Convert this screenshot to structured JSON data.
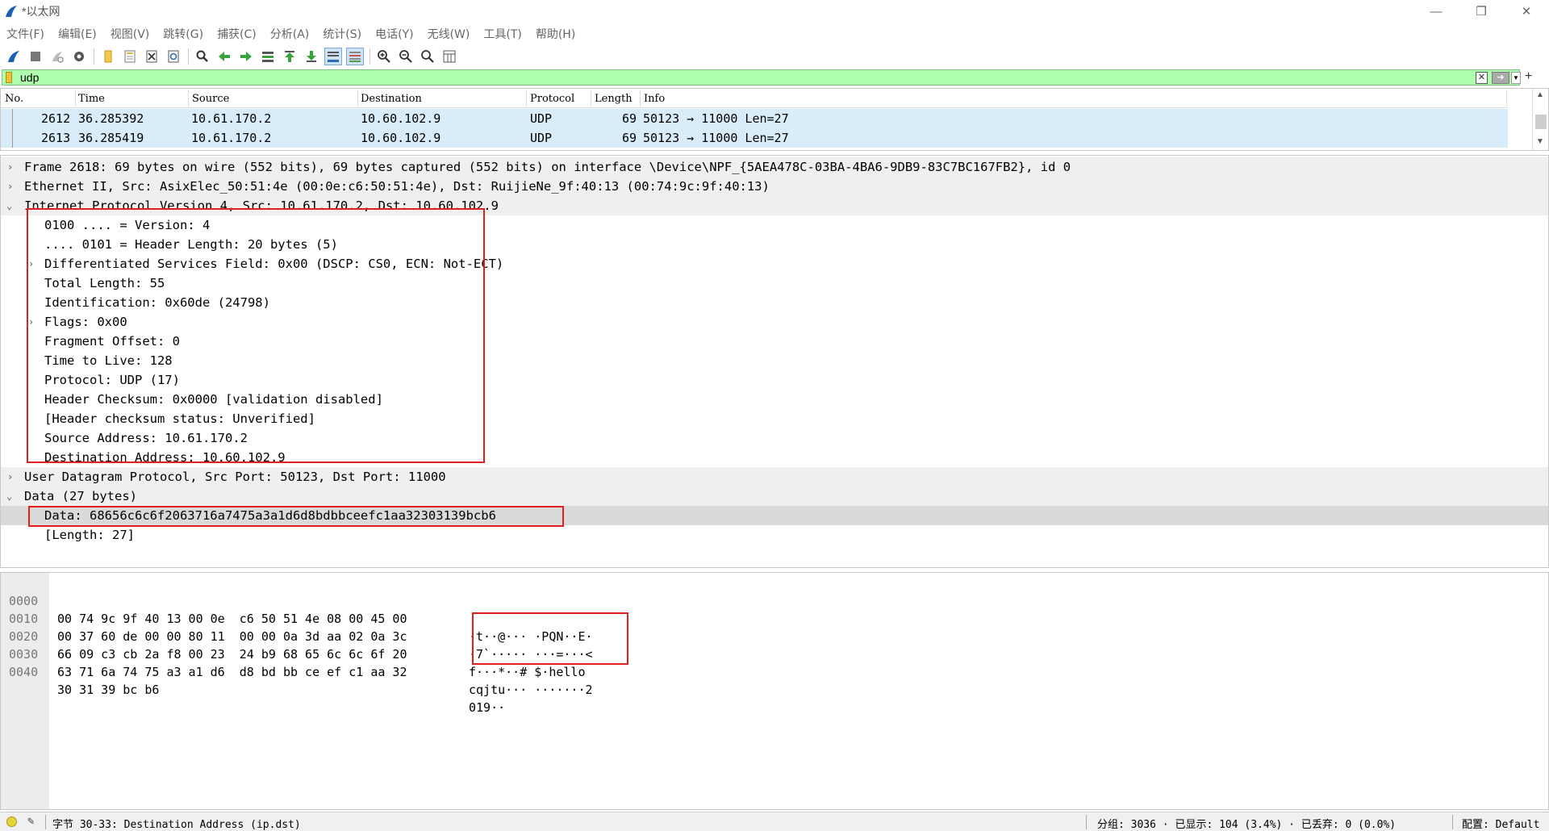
{
  "window": {
    "title": "*以太网",
    "controls": [
      "minimize-icon",
      "restore-icon",
      "close-icon"
    ]
  },
  "menu": [
    "文件(F)",
    "编辑(E)",
    "视图(V)",
    "跳转(G)",
    "捕获(C)",
    "分析(A)",
    "统计(S)",
    "电话(Y)",
    "无线(W)",
    "工具(T)",
    "帮助(H)"
  ],
  "toolbar": {
    "icons": [
      "shark-fin-start-icon",
      "stop-square-icon",
      "restart-capture-icon",
      "capture-options-gear-icon",
      "open-folder-icon",
      "save-file-icon",
      "close-file-icon",
      "reload-icon",
      "find-packet-icon",
      "go-back-icon",
      "go-forward-icon",
      "go-to-packet-icon",
      "go-first-icon",
      "go-last-icon",
      "autoscroll-icon",
      "colorize-icon",
      "zoom-in-icon",
      "zoom-out-icon",
      "zoom-reset-icon",
      "resize-columns-icon"
    ]
  },
  "filter": {
    "value": "udp",
    "color": "#afffaf"
  },
  "packet_list": {
    "columns": [
      "No.",
      "Time",
      "Source",
      "Destination",
      "Protocol",
      "Length",
      "Info"
    ],
    "rows": [
      {
        "no": "2612",
        "time": "36.285392",
        "src": "10.61.170.2",
        "dst": "10.60.102.9",
        "proto": "UDP",
        "len": "69",
        "info": "50123 → 11000 Len=27"
      },
      {
        "no": "2613",
        "time": "36.285419",
        "src": "10.61.170.2",
        "dst": "10.60.102.9",
        "proto": "UDP",
        "len": "69",
        "info": "50123 → 11000 Len=27"
      }
    ],
    "row_color": "#d9ecfa"
  },
  "detail": {
    "lines": [
      {
        "indent": 0,
        "expander": "collapsed",
        "text": "Frame 2618: 69 bytes on wire (552 bits), 69 bytes captured (552 bits) on interface \\Device\\NPF_{5AEA478C-03BA-4BA6-9DB9-83C7BC167FB2}, id 0"
      },
      {
        "indent": 0,
        "expander": "collapsed",
        "text": "Ethernet II, Src: AsixElec_50:51:4e (00:0e:c6:50:51:4e), Dst: RuijieNe_9f:40:13 (00:74:9c:9f:40:13)"
      },
      {
        "indent": 0,
        "expander": "expanded",
        "text": "Internet Protocol Version 4, Src: 10.61.170.2, Dst: 10.60.102.9"
      },
      {
        "indent": 1,
        "expander": "none",
        "text": "0100 .... = Version: 4"
      },
      {
        "indent": 1,
        "expander": "none",
        "text": ".... 0101 = Header Length: 20 bytes (5)"
      },
      {
        "indent": 1,
        "expander": "collapsed",
        "text": "Differentiated Services Field: 0x00 (DSCP: CS0, ECN: Not-ECT)"
      },
      {
        "indent": 1,
        "expander": "none",
        "text": "Total Length: 55"
      },
      {
        "indent": 1,
        "expander": "none",
        "text": "Identification: 0x60de (24798)"
      },
      {
        "indent": 1,
        "expander": "collapsed",
        "text": "Flags: 0x00"
      },
      {
        "indent": 1,
        "expander": "none",
        "text": "Fragment Offset: 0"
      },
      {
        "indent": 1,
        "expander": "none",
        "text": "Time to Live: 128"
      },
      {
        "indent": 1,
        "expander": "none",
        "text": "Protocol: UDP (17)"
      },
      {
        "indent": 1,
        "expander": "none",
        "text": "Header Checksum: 0x0000 [validation disabled]"
      },
      {
        "indent": 1,
        "expander": "none",
        "text": "[Header checksum status: Unverified]"
      },
      {
        "indent": 1,
        "expander": "none",
        "text": "Source Address: 10.61.170.2"
      },
      {
        "indent": 1,
        "expander": "none",
        "text": "Destination Address: 10.60.102.9"
      },
      {
        "indent": 0,
        "expander": "collapsed",
        "text": "User Datagram Protocol, Src Port: 50123, Dst Port: 11000"
      },
      {
        "indent": 0,
        "expander": "expanded",
        "text": "Data (27 bytes)"
      },
      {
        "indent": 1,
        "expander": "none",
        "text": "Data: 68656c6c6f2063716a7475a3a1d6d8bdbbceefc1aa32303139bcb6"
      },
      {
        "indent": 1,
        "expander": "none",
        "text": "[Length: 27]"
      }
    ],
    "highlight_color": "#e02020"
  },
  "hex": {
    "rows": [
      {
        "offset": "0000",
        "bytes": "00 74 9c 9f 40 13 00 0e  c6 50 51 4e 08 00 45 00",
        "ascii": "·t··@··· ·PQN··E·"
      },
      {
        "offset": "0010",
        "bytes": "00 37 60 de 00 00 80 11  00 00 0a 3d aa 02 0a 3c",
        "ascii": "·7`····· ···=···<"
      },
      {
        "offset": "0020",
        "bytes": "66 09 c3 cb 2a f8 00 23  24 b9 68 65 6c 6c 6f 20",
        "ascii": "f···*··# $·hello "
      },
      {
        "offset": "0030",
        "bytes": "63 71 6a 74 75 a3 a1 d6  d8 bd bb ce ef c1 aa 32",
        "ascii": "cqjtu··· ·······2"
      },
      {
        "offset": "0040",
        "bytes": "30 31 39 bc b6",
        "ascii": "019··"
      }
    ]
  },
  "status": {
    "field": "字节 30-33: Destination Address (ip.dst)",
    "packets": "分组: 3036 · 已显示: 104 (3.4%) · 已丢弃: 0 (0.0%)",
    "profile": "配置: Default"
  }
}
